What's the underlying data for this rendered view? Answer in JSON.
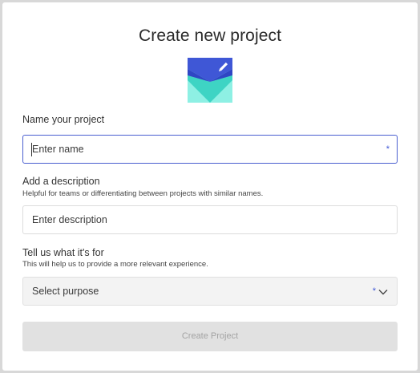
{
  "modal": {
    "title": "Create new project"
  },
  "name_section": {
    "label": "Name your project",
    "placeholder": "Enter name",
    "required_marker": "*"
  },
  "description_section": {
    "label": "Add a description",
    "help": "Helpful for teams or differentiating between projects with similar names.",
    "placeholder": "Enter description"
  },
  "purpose_section": {
    "label": "Tell us what it's for",
    "help": "This will help us to provide a more relevant experience.",
    "placeholder": "Select purpose",
    "required_marker": "*"
  },
  "submit": {
    "label": "Create Project",
    "enabled": false
  },
  "colors": {
    "accent": "#4a5fd0",
    "logo_blue": "#3f57d6",
    "logo_teal": "#3ed4c4",
    "logo_teal_light": "#8ef0e4"
  },
  "icons": {
    "logo": "project-logo-envelope-pencil",
    "dropdown": "chevron-down-icon"
  }
}
